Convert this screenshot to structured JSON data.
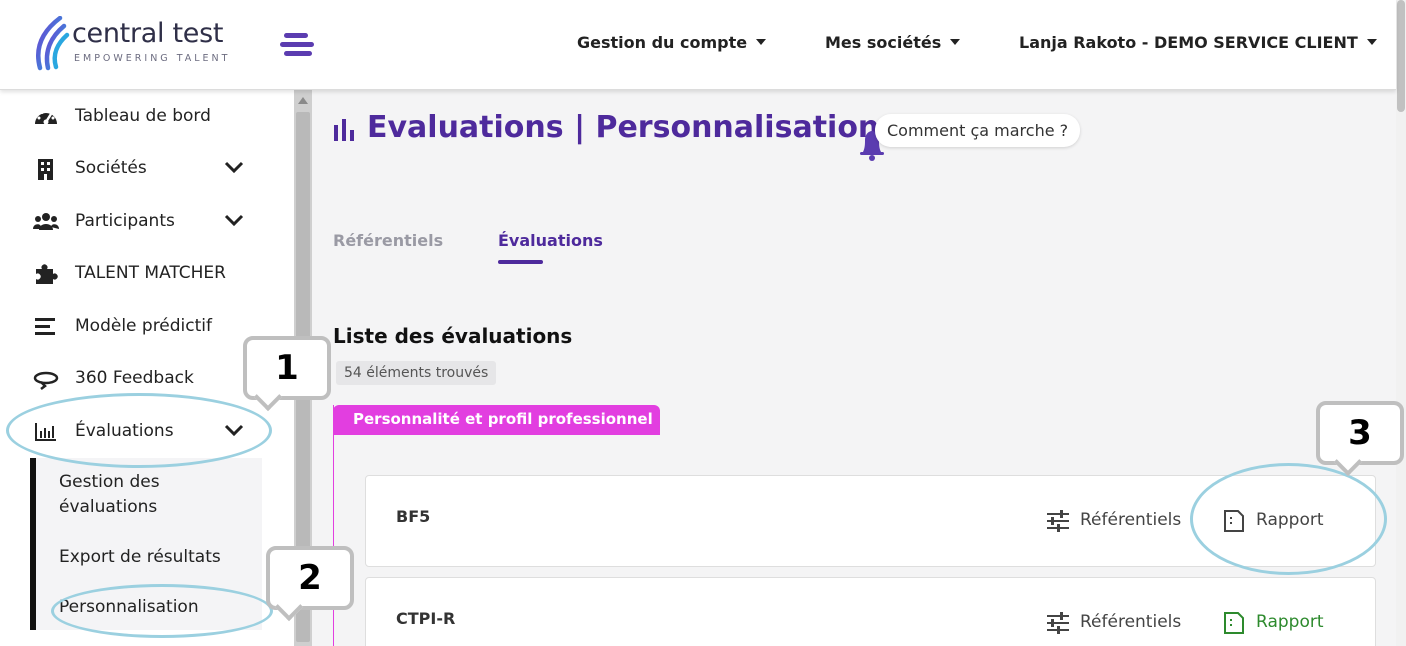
{
  "brand": {
    "name": "central test",
    "tagline": "EMPOWERING TALENT"
  },
  "topnav": {
    "account": "Gestion du compte",
    "companies": "Mes sociétés",
    "user": "Lanja Rakoto - DEMO SERVICE CLIENT"
  },
  "sidebar": {
    "items": [
      {
        "label": "Tableau de bord",
        "icon": "dashboard-icon"
      },
      {
        "label": "Sociétés",
        "icon": "building-icon",
        "expandable": true
      },
      {
        "label": "Participants",
        "icon": "users-icon",
        "expandable": true
      },
      {
        "label": "TALENT MATCHER",
        "icon": "puzzle-icon"
      },
      {
        "label": "Modèle prédictif",
        "icon": "bars-icon"
      },
      {
        "label": "360 Feedback",
        "icon": "rotate-icon"
      },
      {
        "label": "Évaluations",
        "icon": "chart-icon",
        "expandable": true,
        "expanded": true
      }
    ],
    "submenu": [
      {
        "label": "Gestion des évaluations"
      },
      {
        "label": "Export de résultats"
      },
      {
        "label": "Personnalisation",
        "active": true
      }
    ]
  },
  "page": {
    "title": "Evaluations | Personnalisation",
    "help": "Comment ça marche ?",
    "tabs": [
      {
        "label": "Référentiels",
        "active": false
      },
      {
        "label": "Évaluations",
        "active": true
      }
    ],
    "list_title": "Liste des évaluations",
    "count": "54 éléments trouvés",
    "category": "Personnalité et profil professionnel",
    "cards": [
      {
        "name": "BF5",
        "referentiels": "Référentiels",
        "rapport": "Rapport",
        "rapport_state": "default"
      },
      {
        "name": "CTPI-R",
        "referentiels": "Référentiels",
        "rapport": "Rapport",
        "rapport_state": "customized"
      }
    ]
  },
  "annotations": {
    "callout_1": "1",
    "callout_2": "2",
    "callout_3": "3"
  },
  "colors": {
    "primary": "#4e2a9c",
    "category": "#e23ee0",
    "customized": "#2d8a2d",
    "annotation_ring": "#9bd0e0"
  }
}
